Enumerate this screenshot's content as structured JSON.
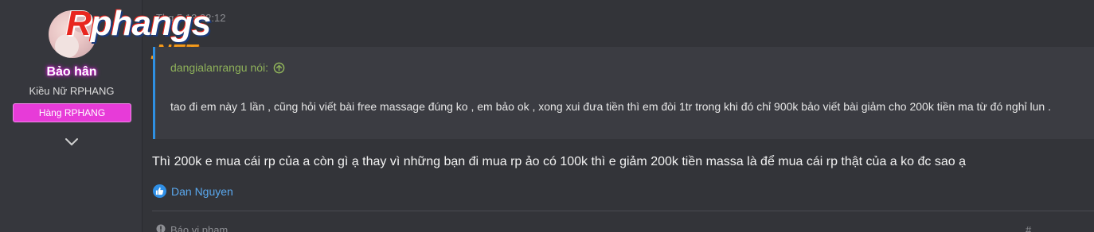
{
  "user": {
    "name": "Bảo hân",
    "title": "Kiều Nữ RPHANG",
    "banner": "Hàng RPHANG"
  },
  "logo": {
    "first_letter": "R",
    "rest": "phangs",
    "suffix": ".NET"
  },
  "post": {
    "timestamp": "Thg 5 13 22:12",
    "quote": {
      "author_line": "dangialanrangu nói:",
      "body": "tao đi em này 1 lần , cũng hỏi viết bài free massage đúng ko , em bảo ok , xong xui đưa tiền thì em đòi 1tr trong khi đó chỉ 900k bảo viết bài giảm cho 200k tiền ma từ đó nghỉ lun ."
    },
    "message": "Thì 200k e mua cái rp của a còn gì ạ thay vì những bạn đi mua rp ảo có 100k thì e giảm 200k tiền massa là để mua cái rp thật của a ko đc sao ạ",
    "reactions": {
      "reactor": "Dan Nguyen"
    },
    "footer": {
      "report": "Báo vi phạm",
      "right": "#"
    }
  },
  "colors": {
    "quote_border": "#2f90e2",
    "quote_author": "#8fb25a",
    "banner": "#e73bd8",
    "link": "#5aa8ee"
  },
  "icons": [
    "chevron-down-icon",
    "arrow-up-circle-icon",
    "like-icon",
    "warning-icon"
  ]
}
